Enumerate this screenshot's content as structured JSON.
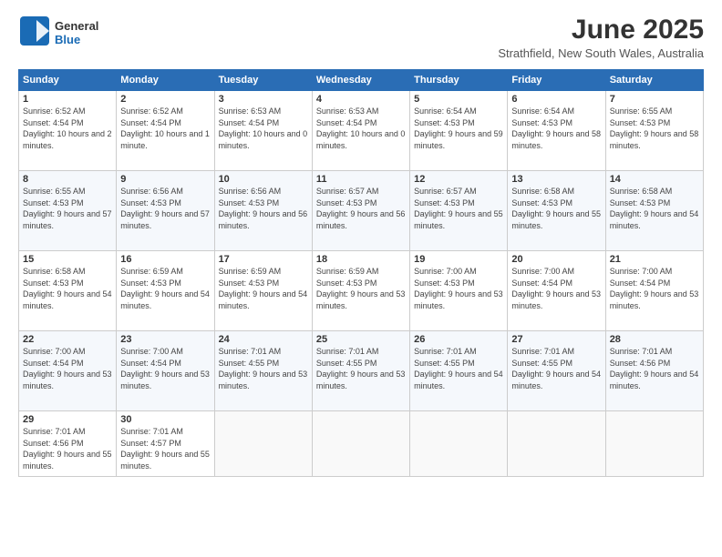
{
  "logo": {
    "general": "General",
    "blue": "Blue"
  },
  "title": "June 2025",
  "location": "Strathfield, New South Wales, Australia",
  "weekdays": [
    "Sunday",
    "Monday",
    "Tuesday",
    "Wednesday",
    "Thursday",
    "Friday",
    "Saturday"
  ],
  "weeks": [
    [
      {
        "day": "1",
        "sunrise": "6:52 AM",
        "sunset": "4:54 PM",
        "daylight": "10 hours and 2 minutes."
      },
      {
        "day": "2",
        "sunrise": "6:52 AM",
        "sunset": "4:54 PM",
        "daylight": "10 hours and 1 minute."
      },
      {
        "day": "3",
        "sunrise": "6:53 AM",
        "sunset": "4:54 PM",
        "daylight": "10 hours and 0 minutes."
      },
      {
        "day": "4",
        "sunrise": "6:53 AM",
        "sunset": "4:54 PM",
        "daylight": "10 hours and 0 minutes."
      },
      {
        "day": "5",
        "sunrise": "6:54 AM",
        "sunset": "4:53 PM",
        "daylight": "9 hours and 59 minutes."
      },
      {
        "day": "6",
        "sunrise": "6:54 AM",
        "sunset": "4:53 PM",
        "daylight": "9 hours and 58 minutes."
      },
      {
        "day": "7",
        "sunrise": "6:55 AM",
        "sunset": "4:53 PM",
        "daylight": "9 hours and 58 minutes."
      }
    ],
    [
      {
        "day": "8",
        "sunrise": "6:55 AM",
        "sunset": "4:53 PM",
        "daylight": "9 hours and 57 minutes."
      },
      {
        "day": "9",
        "sunrise": "6:56 AM",
        "sunset": "4:53 PM",
        "daylight": "9 hours and 57 minutes."
      },
      {
        "day": "10",
        "sunrise": "6:56 AM",
        "sunset": "4:53 PM",
        "daylight": "9 hours and 56 minutes."
      },
      {
        "day": "11",
        "sunrise": "6:57 AM",
        "sunset": "4:53 PM",
        "daylight": "9 hours and 56 minutes."
      },
      {
        "day": "12",
        "sunrise": "6:57 AM",
        "sunset": "4:53 PM",
        "daylight": "9 hours and 55 minutes."
      },
      {
        "day": "13",
        "sunrise": "6:58 AM",
        "sunset": "4:53 PM",
        "daylight": "9 hours and 55 minutes."
      },
      {
        "day": "14",
        "sunrise": "6:58 AM",
        "sunset": "4:53 PM",
        "daylight": "9 hours and 54 minutes."
      }
    ],
    [
      {
        "day": "15",
        "sunrise": "6:58 AM",
        "sunset": "4:53 PM",
        "daylight": "9 hours and 54 minutes."
      },
      {
        "day": "16",
        "sunrise": "6:59 AM",
        "sunset": "4:53 PM",
        "daylight": "9 hours and 54 minutes."
      },
      {
        "day": "17",
        "sunrise": "6:59 AM",
        "sunset": "4:53 PM",
        "daylight": "9 hours and 54 minutes."
      },
      {
        "day": "18",
        "sunrise": "6:59 AM",
        "sunset": "4:53 PM",
        "daylight": "9 hours and 53 minutes."
      },
      {
        "day": "19",
        "sunrise": "7:00 AM",
        "sunset": "4:53 PM",
        "daylight": "9 hours and 53 minutes."
      },
      {
        "day": "20",
        "sunrise": "7:00 AM",
        "sunset": "4:54 PM",
        "daylight": "9 hours and 53 minutes."
      },
      {
        "day": "21",
        "sunrise": "7:00 AM",
        "sunset": "4:54 PM",
        "daylight": "9 hours and 53 minutes."
      }
    ],
    [
      {
        "day": "22",
        "sunrise": "7:00 AM",
        "sunset": "4:54 PM",
        "daylight": "9 hours and 53 minutes."
      },
      {
        "day": "23",
        "sunrise": "7:00 AM",
        "sunset": "4:54 PM",
        "daylight": "9 hours and 53 minutes."
      },
      {
        "day": "24",
        "sunrise": "7:01 AM",
        "sunset": "4:55 PM",
        "daylight": "9 hours and 53 minutes."
      },
      {
        "day": "25",
        "sunrise": "7:01 AM",
        "sunset": "4:55 PM",
        "daylight": "9 hours and 53 minutes."
      },
      {
        "day": "26",
        "sunrise": "7:01 AM",
        "sunset": "4:55 PM",
        "daylight": "9 hours and 54 minutes."
      },
      {
        "day": "27",
        "sunrise": "7:01 AM",
        "sunset": "4:55 PM",
        "daylight": "9 hours and 54 minutes."
      },
      {
        "day": "28",
        "sunrise": "7:01 AM",
        "sunset": "4:56 PM",
        "daylight": "9 hours and 54 minutes."
      }
    ],
    [
      {
        "day": "29",
        "sunrise": "7:01 AM",
        "sunset": "4:56 PM",
        "daylight": "9 hours and 55 minutes."
      },
      {
        "day": "30",
        "sunrise": "7:01 AM",
        "sunset": "4:57 PM",
        "daylight": "9 hours and 55 minutes."
      },
      null,
      null,
      null,
      null,
      null
    ]
  ]
}
